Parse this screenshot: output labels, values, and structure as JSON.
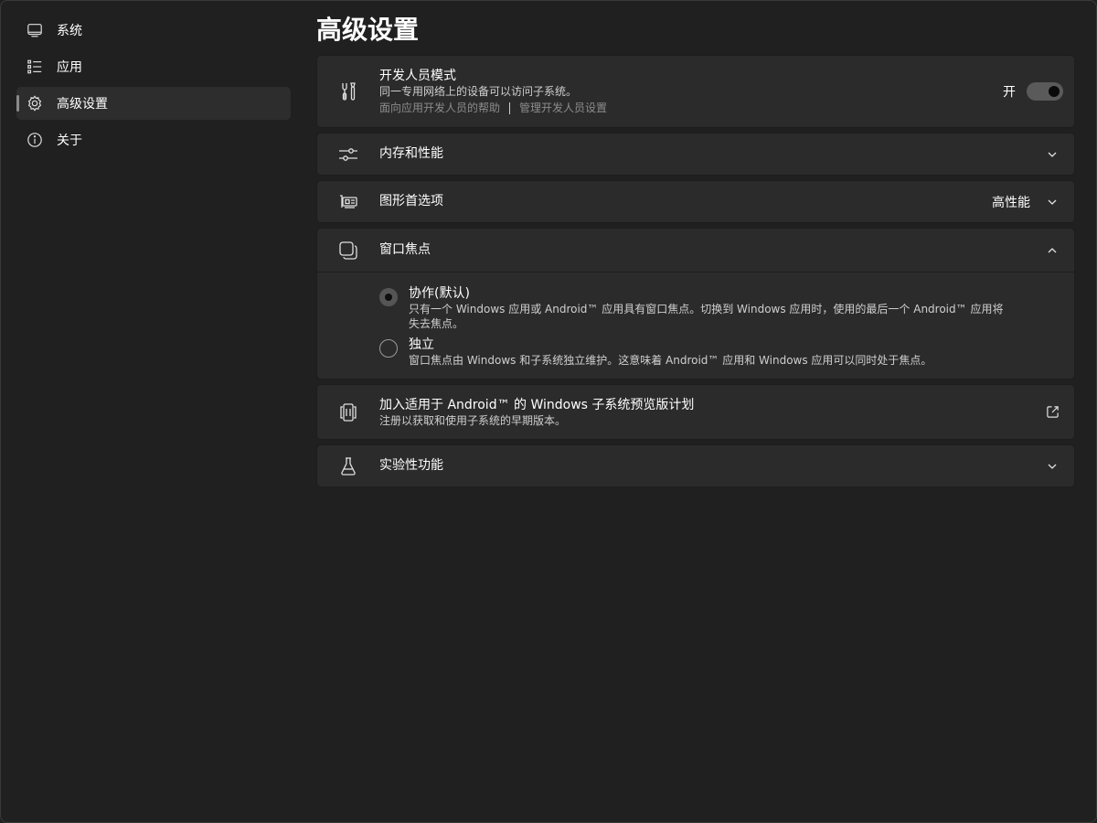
{
  "sidebar": {
    "items": [
      {
        "label": "系统",
        "icon": "monitor-icon"
      },
      {
        "label": "应用",
        "icon": "list-icon"
      },
      {
        "label": "高级设置",
        "icon": "gear-icon"
      },
      {
        "label": "关于",
        "icon": "info-icon"
      }
    ],
    "active": 2
  },
  "page": {
    "title": "高级设置"
  },
  "developer_mode": {
    "title": "开发人员模式",
    "description": "同一专用网络上的设备可以访问子系统。",
    "link_help": "面向应用开发人员的帮助",
    "link_manage": "管理开发人员设置",
    "toggle_label": "开",
    "toggle_on": true,
    "icon": "tools-icon"
  },
  "memory": {
    "title": "内存和性能",
    "icon": "sliders-icon"
  },
  "graphics": {
    "title": "图形首选项",
    "value": "高性能",
    "icon": "gpu-icon"
  },
  "window_focus": {
    "title": "窗口焦点",
    "icon": "window-focus-icon",
    "options": [
      {
        "title": "协作(默认)",
        "description": "只有一个 Windows 应用或 Android™ 应用具有窗口焦点。切换到 Windows 应用时，使用的最后一个 Android™ 应用将失去焦点。",
        "checked": true
      },
      {
        "title": "独立",
        "description": "窗口焦点由 Windows 和子系统独立维护。这意味着 Android™ 应用和 Windows 应用可以同时处于焦点。",
        "checked": false
      }
    ]
  },
  "preview_program": {
    "title": "加入适用于 Android™ 的 Windows 子系统预览版计划",
    "description": "注册以获取和使用子系统的早期版本。",
    "icon": "preview-icon"
  },
  "experimental": {
    "title": "实验性功能",
    "icon": "flask-icon"
  },
  "colors": {
    "background": "#202020",
    "card": "#2b2b2b",
    "toggle_track": "#5a5a5a"
  }
}
